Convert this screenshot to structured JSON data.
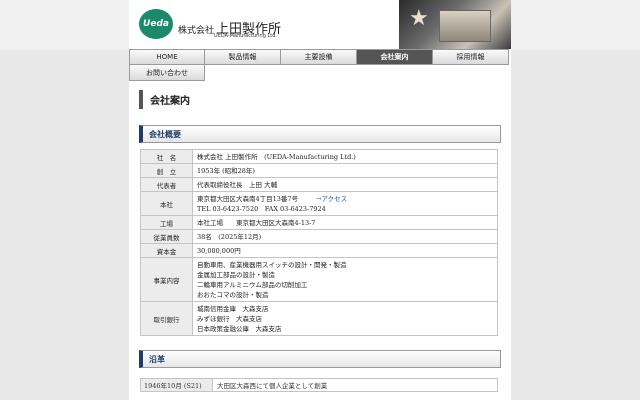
{
  "header": {
    "logo_text": "Ueda",
    "company_prefix": "株式会社",
    "company_name": "上田製作所",
    "company_en": "UEDA-Manufacturing Ltd."
  },
  "nav": {
    "items": [
      {
        "label": "HOME"
      },
      {
        "label": "製品情報"
      },
      {
        "label": "主要設備"
      },
      {
        "label": "会社案内",
        "active": true
      },
      {
        "label": "採用情報"
      },
      {
        "label": "お問い合わせ"
      }
    ]
  },
  "main": {
    "page_title": "会社案内",
    "overview_title": "会社概要",
    "overview": {
      "name_label": "社　名",
      "name_value": "株式会社 上田製作所　(UEDA-Manufacturing Ltd.)",
      "founded_label": "創　立",
      "founded_value": "1953年 (昭和28年)",
      "rep_label": "代表者",
      "rep_value": "代表取締役社長　上田 大輔",
      "hq_label": "本社",
      "hq_address": "東京都大田区大森南4丁目13番7号",
      "hq_link": "→アクセス",
      "hq_phone": "TEL 03-6423-7520　FAX 03-6423-7924",
      "factory_label": "工場",
      "factory_value": "本社工場　　東京都大田区大森南4-13-7",
      "staff_label": "従業員数",
      "staff_value": "38名　(2025年12月)",
      "capital_label": "資本金",
      "capital_value": "30,000,000円",
      "business_label": "事業内容",
      "business_lines": [
        "自動車用、産業機器用スイッチの設計・開発・製造",
        "金属加工部品の設計・製造",
        "二輪車用アルミニウム部品の切削加工",
        "おおたコマの設計・製造"
      ],
      "bank_label": "取引銀行",
      "bank_lines": [
        "城南信用金庫　大森支店",
        "みずほ銀行　大森支店",
        "日本政策金融公庫　大森支店"
      ]
    },
    "history_title": "沿革",
    "history": [
      {
        "date": "1946年10月 (S21)",
        "event": "大田区大森西にて個人企業として創業"
      }
    ]
  }
}
